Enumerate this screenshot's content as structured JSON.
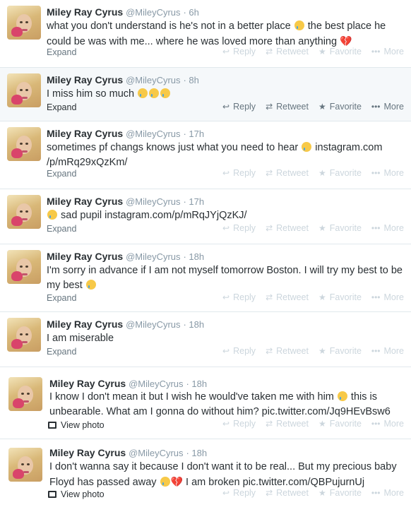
{
  "user": {
    "name": "Miley Ray Cyrus",
    "handle": "@MileyCyrus"
  },
  "actions": {
    "reply": "Reply",
    "retweet": "Retweet",
    "favorite": "Favorite",
    "more": "More"
  },
  "labels": {
    "expand": "Expand",
    "view_photo": "View photo"
  },
  "tweets": [
    {
      "time": "· 6h",
      "line1": "what you don't understand is he's not in a better place ",
      "line1b": " the best place he",
      "line2": "could be was with me... where he was loved more than anything "
    },
    {
      "time": "· 8h",
      "line1": "I miss him so much "
    },
    {
      "time": "· 17h",
      "line1": "sometimes pf changs knows just what you need to hear ",
      "link1": " instagram.com",
      "line2": "/p/mRq29xQzKm/"
    },
    {
      "time": "· 17h",
      "line1": " sad pupil ",
      "link1": "instagram.com/p/mRqJYjQzKJ/"
    },
    {
      "time": "· 18h",
      "line1": "I'm sorry in advance if I am not myself tomorrow Boston. I will try my best to be",
      "line2": "my best "
    },
    {
      "time": "· 18h",
      "line1": "I am miserable"
    },
    {
      "time": "· 18h",
      "line1": "I know I don't mean it but I wish he would've taken me with him ",
      "line1b": " this is",
      "line2": "unbearable. What am I gonna do without him? ",
      "link2": "pic.twitter.com/Jq9HEvBsw6"
    },
    {
      "time": "· 18h",
      "line1": "I don't wanna say it because I don't want it to be real... But my precious baby",
      "line2": "Floyd has passed away ",
      "line2b": " I am broken ",
      "link2": "pic.twitter.com/QBPujurnUj"
    }
  ]
}
